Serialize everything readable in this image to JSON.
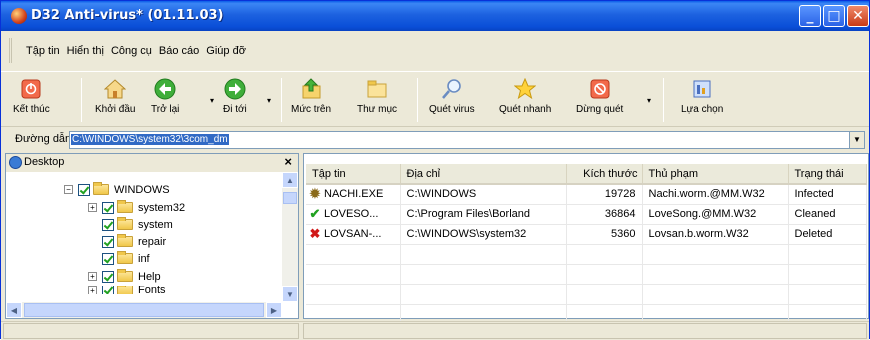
{
  "window": {
    "title": "D32 Anti-virus* (01.11.03)",
    "controls": {
      "minimize": "_",
      "maximize": "□",
      "close": "✕"
    }
  },
  "menu": [
    "Tập tin",
    "Hiển thị",
    "Công cụ",
    "Báo cáo",
    "Giúp đỡ"
  ],
  "toolbar": {
    "exit": "Kết thúc",
    "start": "Khởi đầu",
    "back": "Trở lại",
    "forward": "Đi tới",
    "up": "Mức trên",
    "folders": "Thư mục",
    "scan": "Quét virus",
    "quick_scan": "Quét nhanh",
    "stop": "Dừng quét",
    "options": "Lựa chọn"
  },
  "path": {
    "label": "Đường dẫn",
    "value": "C:\\WINDOWS\\system32\\3com_dm"
  },
  "tree": {
    "header": "Desktop",
    "close": "×",
    "nodes": [
      "WINDOWS",
      "system32",
      "system",
      "repair",
      "inf",
      "Help",
      "Fonts"
    ]
  },
  "table": {
    "columns": [
      "Tập tin",
      "Địa chỉ",
      "Kích thước",
      "Thủ phạm",
      "Trạng thái"
    ],
    "rows": [
      {
        "file": "NACHI.EXE",
        "path": "C:\\WINDOWS",
        "size": "19728",
        "culprit": "Nachi.worm.@MM.W32",
        "status": "Infected",
        "icon": "virus-icon"
      },
      {
        "file": "LOVESO...",
        "path": "C:\\Program Files\\Borland",
        "size": "36864",
        "culprit": "LoveSong.@MM.W32",
        "status": "Cleaned",
        "icon": "check-icon"
      },
      {
        "file": "LOVSAN-...",
        "path": "C:\\WINDOWS\\system32",
        "size": "5360",
        "culprit": "Lovsan.b.worm.W32",
        "status": "Deleted",
        "icon": "x-icon"
      }
    ]
  },
  "colors": {
    "title_blue": "#0a4fd8",
    "selection": "#316ac5",
    "infected": "#8a6a1a",
    "cleaned": "#21a121",
    "deleted": "#d01818"
  }
}
